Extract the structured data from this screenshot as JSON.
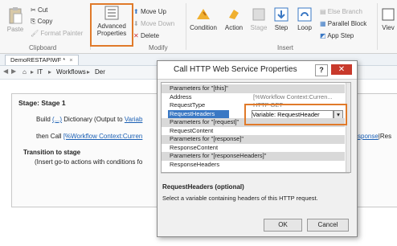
{
  "ribbon": {
    "paste": "Paste",
    "cut": "Cut",
    "copy": "Copy",
    "format_painter": "Format Painter",
    "clipboard_group": "Clipboard",
    "advanced_line1": "Advanced",
    "advanced_line2": "Properties",
    "move_up": "Move Up",
    "move_down": "Move Down",
    "delete": "Delete",
    "modify_group": "Modify",
    "condition": "Condition",
    "action": "Action",
    "stage": "Stage",
    "step": "Step",
    "loop": "Loop",
    "else_branch": "Else Branch",
    "parallel_block": "Parallel Block",
    "app_step": "App Step",
    "insert_group": "Insert",
    "view": "Viev"
  },
  "tab": {
    "label": "DemoRESTAPIWF *"
  },
  "breadcrumb": {
    "root": "IT",
    "item1": "Workflows",
    "item2": "Der"
  },
  "stage": {
    "title": "Stage: Stage 1",
    "line1_prefix": "Build",
    "line1_link": "(...)",
    "line1_rest": "Dictionary (Output to",
    "line1_var": "Variab",
    "line2_prefix": "then Call",
    "line2_link": "[%Workflow Context:Curren",
    "line2_right_link": "sponse",
    "line2_right_rest": "|Res",
    "transition_title": "Transition to stage",
    "transition_text": "(Insert go-to actions with conditions fo"
  },
  "dialog": {
    "title": "Call HTTP Web Service Properties",
    "help": "?",
    "rows": [
      {
        "type": "cat",
        "name": "Parameters for \"[this]\""
      },
      {
        "type": "prop",
        "name": "Address",
        "value": "[%Workflow Context:Curren..."
      },
      {
        "type": "prop",
        "name": "RequestType",
        "value": "HTTP GET"
      },
      {
        "type": "sel",
        "name": "RequestHeaders",
        "value": "Variable: RequestHeader"
      },
      {
        "type": "cat",
        "name": "Parameters for \"[request]\""
      },
      {
        "type": "prop",
        "name": "RequestContent",
        "value": ""
      },
      {
        "type": "cat",
        "name": "Parameters for \"[response]\""
      },
      {
        "type": "prop",
        "name": "ResponseContent",
        "value": ""
      },
      {
        "type": "cat",
        "name": "Parameters for \"[responseHeaders]\""
      },
      {
        "type": "prop",
        "name": "ResponseHeaders",
        "value": ""
      }
    ],
    "desc_title": "RequestHeaders (optional)",
    "desc_text": "Select a variable containing headers of this HTTP request.",
    "ok": "OK",
    "cancel": "Cancel"
  },
  "colors": {
    "highlight": "#e07a2a",
    "link": "#1a5fb4",
    "selected_row": "#3a78c4"
  }
}
